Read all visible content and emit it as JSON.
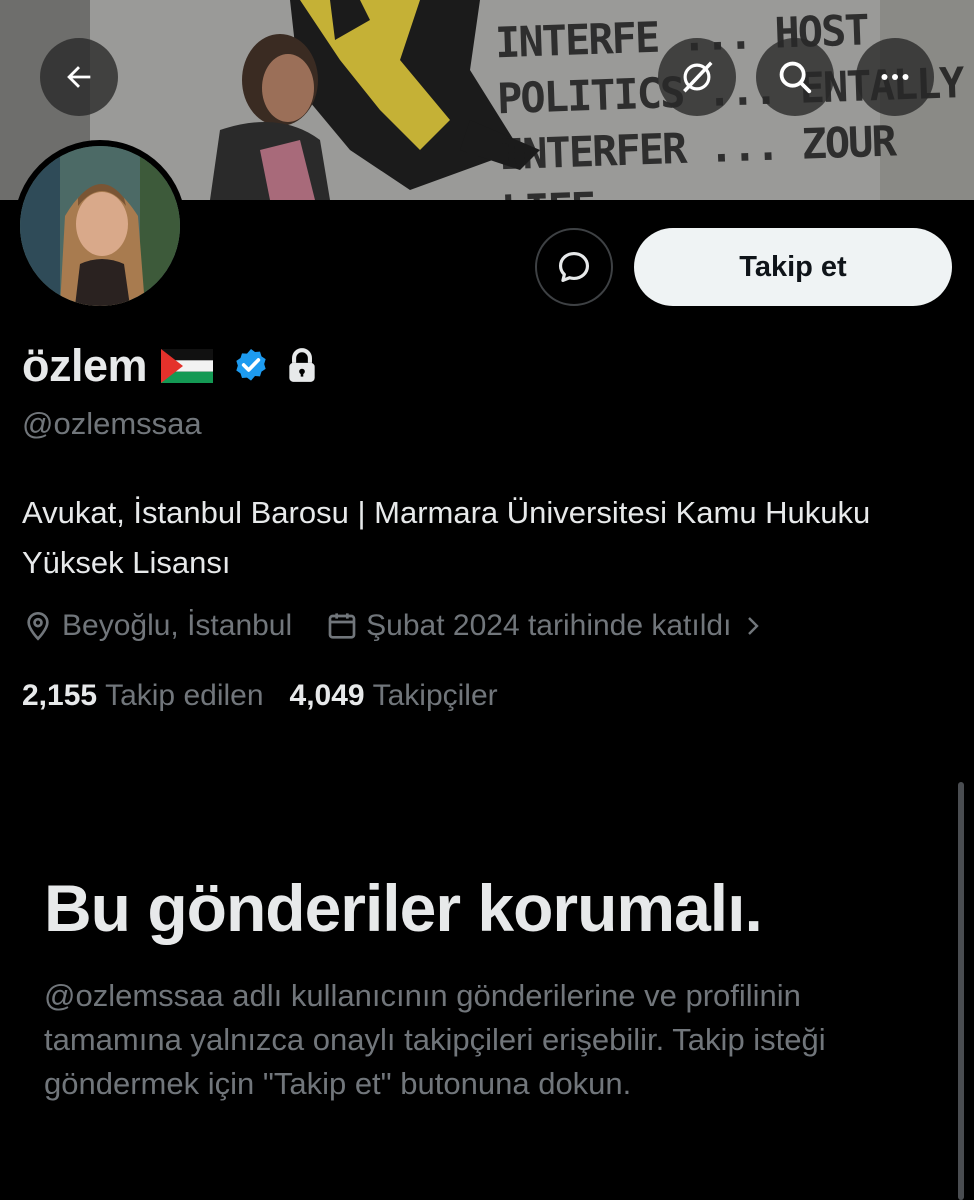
{
  "header": {
    "back_icon": "arrow-left-icon",
    "grok_icon": "grok-icon",
    "search_icon": "search-icon",
    "more_icon": "more-horizontal-icon"
  },
  "banner": {
    "lines": [
      "INTERFE  ...  HOST",
      "POLITICS  ...  ENTALLY",
      "INTERFER  ...  ZOUR",
      "LIFE."
    ]
  },
  "profile": {
    "display_name": "özlem",
    "flag_emoji": "palestine-flag",
    "verified_icon": "verified-badge-icon",
    "lock_icon": "lock-icon",
    "handle": "@ozlemssaa",
    "bio": "Avukat, İstanbul Barosu | Marmara Üniversitesi Kamu Hukuku Yüksek Lisansı",
    "location": "Beyoğlu, İstanbul",
    "joined": "Şubat 2024 tarihinde katıldı",
    "following_count": "2,155",
    "following_label": "Takip edilen",
    "followers_count": "4,049",
    "followers_label": "Takipçiler"
  },
  "actions": {
    "message_icon": "message-bubble-icon",
    "follow_label": "Takip et"
  },
  "protected": {
    "title": "Bu gönderiler korumalı.",
    "description": "@ozlemssaa adlı kullanıcının gönderilerine ve profilinin tamamına yalnızca onaylı takipçileri erişebilir. Takip isteği göndermek için \"Takip et\" butonuna dokun."
  },
  "colors": {
    "background": "#000000",
    "primary_text": "#e7e9ea",
    "secondary_text": "#71767b",
    "verified_blue": "#1d9bf0",
    "follow_button_bg": "#eff3f4"
  }
}
